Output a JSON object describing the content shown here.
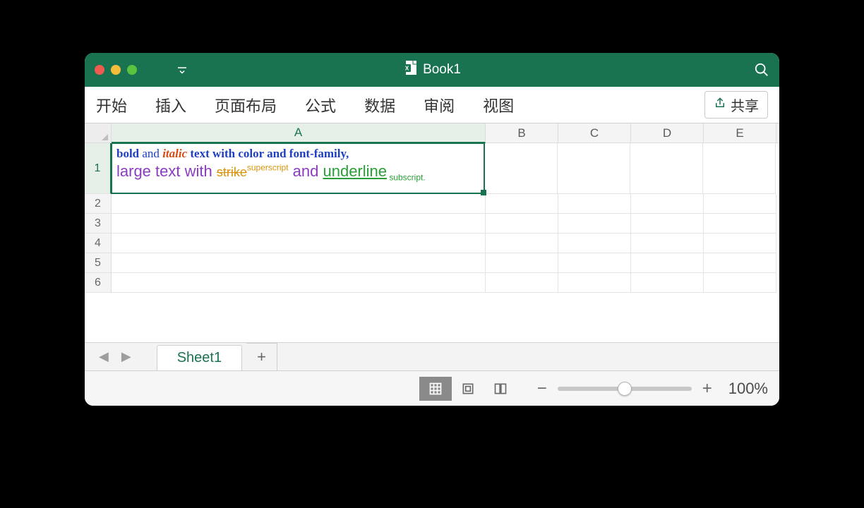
{
  "title": "Book1",
  "ribbon": {
    "tabs": [
      "开始",
      "插入",
      "页面布局",
      "公式",
      "数据",
      "审阅",
      "视图"
    ],
    "share_label": "共享"
  },
  "columns": [
    "A",
    "B",
    "C",
    "D",
    "E"
  ],
  "rows": [
    "1",
    "2",
    "3",
    "4",
    "5",
    "6"
  ],
  "cell_a1": {
    "line1": {
      "bold": "bold",
      "and": "and",
      "italic": "italic",
      "rest": " text with color and font-family,"
    },
    "line2": {
      "prefix": "large text with ",
      "strike": "strike",
      "superscript": "superscript",
      "and": " and ",
      "underline": "underline",
      "subscript": " subscript."
    }
  },
  "sheet_tabs": {
    "active": "Sheet1"
  },
  "status": {
    "zoom_label": "100%"
  }
}
